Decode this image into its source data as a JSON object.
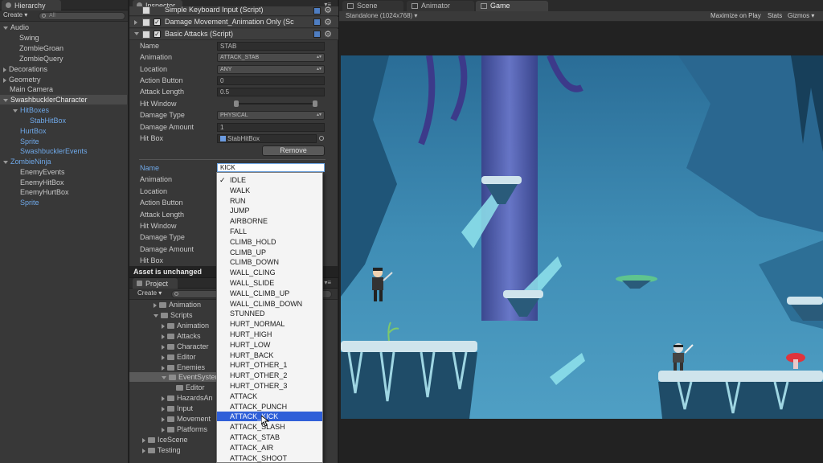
{
  "hierarchy": {
    "tab": "Hierarchy",
    "create": "Create",
    "search": "All",
    "items": [
      {
        "label": "Audio"
      },
      {
        "label": "Swing"
      },
      {
        "label": "ZombieGroan"
      },
      {
        "label": "ZombieQuery"
      },
      {
        "label": "Decorations"
      },
      {
        "label": "Geometry"
      },
      {
        "label": "Main Camera"
      },
      {
        "label": "SwashbucklerCharacter"
      },
      {
        "label": "HitBoxes"
      },
      {
        "label": "StabHitBox"
      },
      {
        "label": "HurtBox"
      },
      {
        "label": "Sprite"
      },
      {
        "label": "SwashbucklerEvents"
      },
      {
        "label": "ZombieNinja"
      },
      {
        "label": "EnemyEvents"
      },
      {
        "label": "EnemyHitBox"
      },
      {
        "label": "EnemyHurtBox"
      },
      {
        "label": "Sprite"
      }
    ]
  },
  "inspector": {
    "tab": "Inspector",
    "components": [
      {
        "title": "Simple Keyboard Input (Script)"
      },
      {
        "title": "Damage Movement_Animation Only (Sc"
      },
      {
        "title": "Basic Attacks (Script)"
      }
    ],
    "attack1": {
      "name_label": "Name",
      "name_value": "STAB",
      "animation_label": "Animation",
      "animation_value": "ATTACK_STAB",
      "location_label": "Location",
      "location_value": "ANY",
      "action_label": "Action Button",
      "action_value": "0",
      "length_label": "Attack Length",
      "length_value": "0.5",
      "window_label": "Hit Window",
      "dtype_label": "Damage Type",
      "dtype_value": "PHYSICAL",
      "damount_label": "Damage Amount",
      "damount_value": "1",
      "hitbox_label": "Hit Box",
      "hitbox_value": "StabHitBox"
    },
    "remove": "Remove",
    "attack2": {
      "name_label": "Name",
      "name_value": "KICK",
      "animation_label": "Animation",
      "location_label": "Location",
      "action_label": "Action Button",
      "length_label": "Attack Length",
      "window_label": "Hit Window",
      "dtype_label": "Damage Type",
      "damount_label": "Damage Amount",
      "hitbox_label": "Hit Box"
    },
    "status": "Asset is unchanged"
  },
  "project": {
    "tab": "Project",
    "create": "Create",
    "items": [
      {
        "label": "Animation"
      },
      {
        "label": "Scripts"
      },
      {
        "label": "Animation"
      },
      {
        "label": "Attacks"
      },
      {
        "label": "Character"
      },
      {
        "label": "Editor"
      },
      {
        "label": "Enemies"
      },
      {
        "label": "EventSyster"
      },
      {
        "label": "Editor"
      },
      {
        "label": "HazardsAn"
      },
      {
        "label": "Input"
      },
      {
        "label": "Movement"
      },
      {
        "label": "Platforms"
      },
      {
        "label": "IceScene"
      },
      {
        "label": "Testing"
      }
    ]
  },
  "game": {
    "tabs": [
      {
        "label": "Scene"
      },
      {
        "label": "Animator"
      },
      {
        "label": "Game"
      }
    ],
    "resolution": "Standalone (1024x768)",
    "maximize": "Maximize on Play",
    "stats": "Stats",
    "gizmos": "Gizmos"
  },
  "dropdown": {
    "selected": "IDLE",
    "items": [
      "IDLE",
      "WALK",
      "RUN",
      "JUMP",
      "AIRBORNE",
      "FALL",
      "CLIMB_HOLD",
      "CLIMB_UP",
      "CLIMB_DOWN",
      "WALL_CLING",
      "WALL_SLIDE",
      "WALL_CLIMB_UP",
      "WALL_CLIMB_DOWN",
      "STUNNED",
      "HURT_NORMAL",
      "HURT_HIGH",
      "HURT_LOW",
      "HURT_BACK",
      "HURT_OTHER_1",
      "HURT_OTHER_2",
      "HURT_OTHER_3",
      "ATTACK",
      "ATTACK_PUNCH",
      "ATTACK_KICK",
      "ATTACK_SLASH",
      "ATTACK_STAB",
      "ATTACK_AIR",
      "ATTACK_SHOOT"
    ],
    "highlighted": "ATTACK_KICK"
  },
  "colors": {
    "panel": "#383838",
    "highlight": "#2f5fd8",
    "sky": "#3f8db5",
    "ice": "#cfe4ec"
  }
}
